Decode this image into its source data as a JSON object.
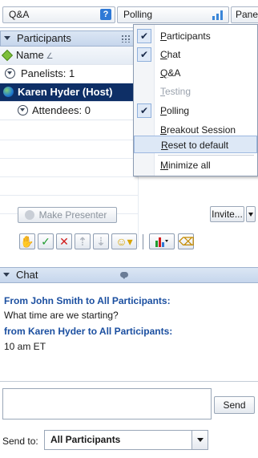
{
  "toolbar": {
    "qa_label": "Q&A",
    "qa_help": "?",
    "polling_label": "Polling",
    "panels_label": "Panels"
  },
  "participants": {
    "title": "Participants",
    "name_header": "Name",
    "panelists": "Panelists: 1",
    "host": "Karen Hyder (Host)",
    "attendees": "Attendees: 0",
    "make_presenter": "Make Presenter",
    "invite": "Invite...",
    "tools": [
      "raise-hand",
      "check",
      "cross",
      "go-faster",
      "go-slower",
      "emoticon",
      "chart",
      "eraser"
    ]
  },
  "panels_menu": {
    "items": [
      {
        "label": "Participants",
        "underline": "P",
        "rest": "articipants",
        "checked": true
      },
      {
        "label": "Chat",
        "underline": "C",
        "rest": "hat",
        "checked": true
      },
      {
        "label": "Q&A",
        "underline": "Q",
        "rest": "&A",
        "checked": false
      },
      {
        "label": "Testing",
        "underline": "T",
        "rest": "esting",
        "checked": false,
        "disabled": true
      },
      {
        "label": "Polling",
        "underline": "P",
        "rest": "olling",
        "checked": true
      },
      {
        "label": "Breakout Session",
        "underline": "B",
        "rest": "reakout Session",
        "checked": false
      },
      {
        "label": "Reset to default",
        "underline": "R",
        "rest": "eset to default",
        "highlighted": true
      },
      {
        "label": "Minimize all",
        "underline": "M",
        "rest": "inimize all"
      }
    ]
  },
  "chat": {
    "title": "Chat",
    "messages": [
      {
        "from": "From John Smith to All Participants:",
        "text": "What time are we starting?"
      },
      {
        "from": "from Karen Hyder to All Participants:",
        "text": "10 am ET"
      }
    ],
    "send": "Send",
    "send_to_label": "Send to:",
    "send_to_value": "All Participants"
  },
  "colors": {
    "host_row_bg": "#0e2f66",
    "chat_from": "#1b4fa0",
    "header_bg": "#c6d6ec"
  }
}
